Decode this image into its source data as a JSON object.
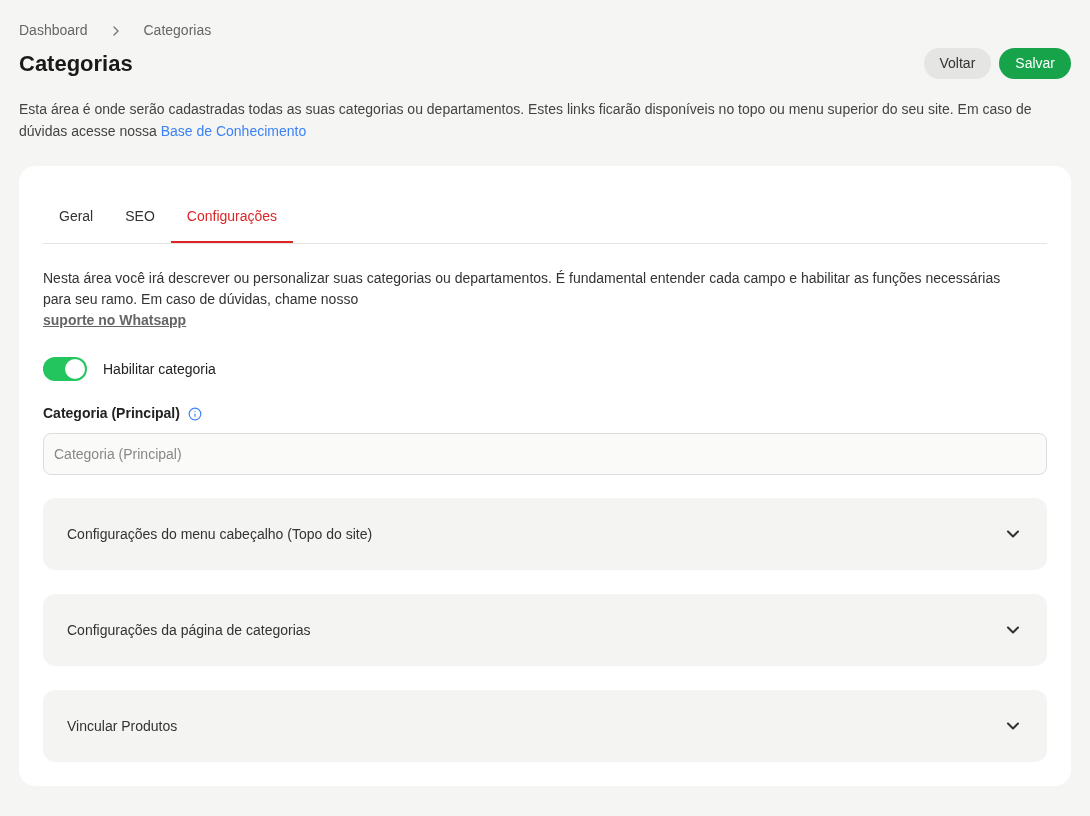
{
  "breadcrumb": [
    {
      "label": "Dashboard"
    },
    {
      "label": "Categorias"
    }
  ],
  "title": "Categorias",
  "buttons": [
    {
      "label": "Voltar",
      "kind": "secondary"
    },
    {
      "label": "Salvar",
      "kind": "primary"
    }
  ],
  "intro": {
    "text": "Esta área é onde serão cadastradas todas as suas categorias ou departamentos. Estes links ficarão disponíveis no topo ou menu superior do seu site. Em caso de dúvidas acesse nossa",
    "link": "Base de Conhecimento"
  },
  "tabs": [
    {
      "label": "Geral",
      "selected": false
    },
    {
      "label": "SEO",
      "selected": false
    },
    {
      "label": "Configurações",
      "selected": true
    }
  ],
  "section_intro": {
    "text": "Nesta área você irá descrever ou personalizar suas categorias ou departamentos. É fundamental entender cada campo e habilitar as funções necessárias para seu ramo. Em caso de dúvidas, chame nosso",
    "link": "suporte no Whatsapp"
  },
  "toggle": {
    "label": "Habilitar categoria",
    "on": true
  },
  "field": {
    "label": "Categoria (Principal)",
    "placeholder": "Categoria (Principal)"
  },
  "accordions": [
    {
      "title": "Configurações do menu cabeçalho (Topo do site)",
      "expanded": false
    },
    {
      "title": "Configurações da página de categorias",
      "expanded": false
    },
    {
      "title": "Vincular Produtos",
      "expanded": false
    }
  ]
}
